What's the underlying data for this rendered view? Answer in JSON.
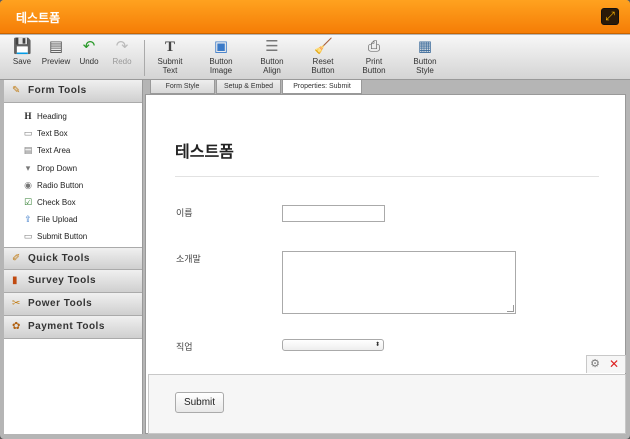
{
  "window": {
    "title": "테스트폼"
  },
  "toolbar": {
    "buttons": [
      {
        "label": "Save",
        "icon": "save-icon"
      },
      {
        "label": "Preview",
        "icon": "preview-icon"
      },
      {
        "label": "Undo",
        "icon": "undo-icon"
      },
      {
        "label": "Redo",
        "icon": "redo-icon",
        "disabled": true
      },
      {
        "label1": "Submit",
        "label2": "Text",
        "icon": "text-icon"
      },
      {
        "label1": "Button",
        "label2": "Image",
        "icon": "image-icon"
      },
      {
        "label1": "Button",
        "label2": "Align",
        "icon": "align-icon"
      },
      {
        "label1": "Reset",
        "label2": "Button",
        "icon": "broom-icon"
      },
      {
        "label1": "Print",
        "label2": "Button",
        "icon": "printer-icon"
      },
      {
        "label1": "Button",
        "label2": "Style",
        "icon": "style-icon"
      }
    ]
  },
  "sidebar": {
    "form_tools": {
      "label": "Form Tools",
      "items": [
        {
          "label": "Heading",
          "icon": "heading-icon"
        },
        {
          "label": "Text Box",
          "icon": "textbox-icon"
        },
        {
          "label": "Text Area",
          "icon": "textarea-icon"
        },
        {
          "label": "Drop Down",
          "icon": "dropdown-icon"
        },
        {
          "label": "Radio Button",
          "icon": "radio-icon"
        },
        {
          "label": "Check Box",
          "icon": "checkbox-icon"
        },
        {
          "label": "File Upload",
          "icon": "upload-icon"
        },
        {
          "label": "Submit Button",
          "icon": "submit-icon"
        }
      ]
    },
    "categories": [
      {
        "label": "Quick Tools",
        "icon": "wand-icon"
      },
      {
        "label": "Survey Tools",
        "icon": "bar-chart-icon"
      },
      {
        "label": "Power Tools",
        "icon": "tools-icon"
      },
      {
        "label": "Payment Tools",
        "icon": "payment-icon"
      }
    ]
  },
  "tabs": [
    {
      "label": "Form Style"
    },
    {
      "label": "Setup & Embed"
    },
    {
      "label": "Properties: Submit",
      "active": true
    }
  ],
  "form": {
    "title": "테스트폼",
    "fields": {
      "name_label": "이름",
      "comment_label": "소개말",
      "job_label": "직업"
    },
    "submit_label": "Submit"
  },
  "colors": {
    "titlebar": "#f68a0d",
    "accent_close": "#dd2222"
  }
}
